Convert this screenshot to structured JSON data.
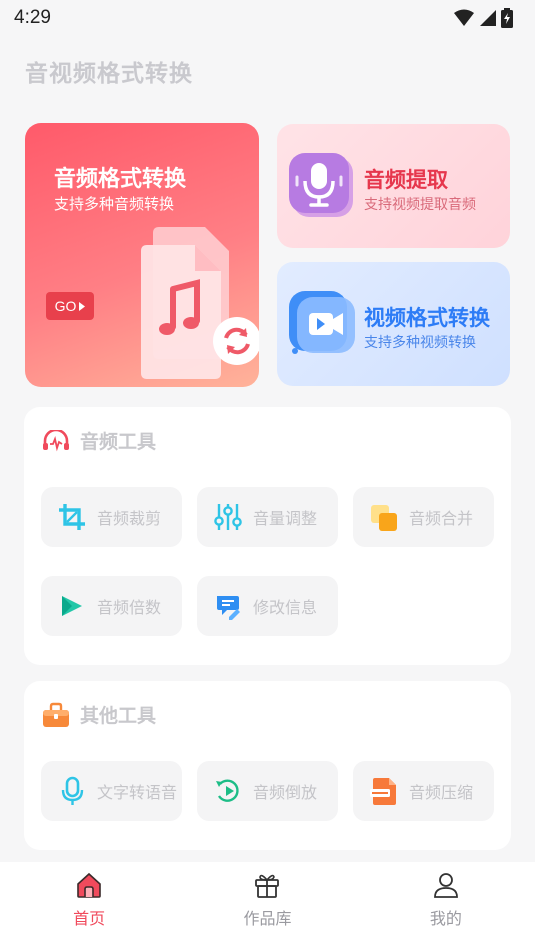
{
  "status_bar": {
    "time": "4:29"
  },
  "page": {
    "title": "音视频格式转换"
  },
  "hero": {
    "main": {
      "title": "音频格式转换",
      "subtitle": "支持多种音频转换",
      "go_label": "GO"
    },
    "extract": {
      "title": "音频提取",
      "subtitle": "支持视频提取音频"
    },
    "video": {
      "title": "视频格式转换",
      "subtitle": "支持多种视频转换"
    }
  },
  "audio_tools": {
    "title": "音频工具",
    "items": [
      {
        "label": "音频裁剪",
        "icon": "crop-icon"
      },
      {
        "label": "音量调整",
        "icon": "equalizer-icon"
      },
      {
        "label": "音频合并",
        "icon": "merge-icon"
      },
      {
        "label": "音频倍数",
        "icon": "speed-icon"
      },
      {
        "label": "修改信息",
        "icon": "edit-info-icon"
      }
    ]
  },
  "other_tools": {
    "title": "其他工具",
    "items": [
      {
        "label": "文字转语音",
        "icon": "microphone-icon"
      },
      {
        "label": "音频倒放",
        "icon": "rewind-icon"
      },
      {
        "label": "音频压缩",
        "icon": "compress-file-icon"
      }
    ]
  },
  "bottom_nav": {
    "items": [
      {
        "label": "首页",
        "icon": "home-icon",
        "active": true
      },
      {
        "label": "作品库",
        "icon": "gift-box-icon",
        "active": false
      },
      {
        "label": "我的",
        "icon": "person-icon",
        "active": false
      }
    ]
  },
  "colors": {
    "accent": "#f04a5c",
    "video_blue": "#2d7cf6",
    "hero_red": "#ff5a6a"
  }
}
